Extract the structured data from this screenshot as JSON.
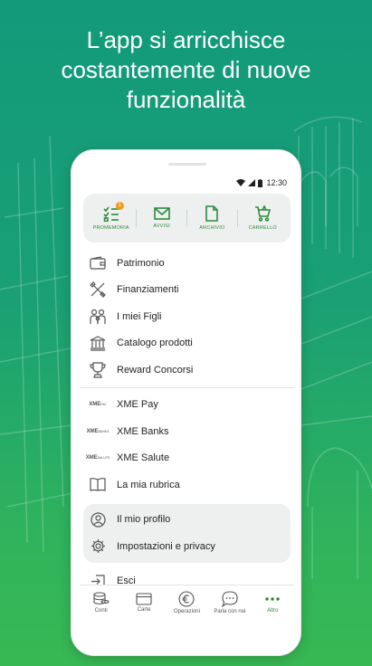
{
  "headline": {
    "line1": "L’app si arricchisce",
    "line2": "costantemente di nuove",
    "line3": "funzionalità"
  },
  "status_bar": {
    "time": "12:30"
  },
  "quick_actions": [
    {
      "label": "PROMEMORIA",
      "icon": "checklist-icon",
      "badge": "1"
    },
    {
      "label": "AVVISI",
      "icon": "envelope-icon"
    },
    {
      "label": "ARCHIVIO",
      "icon": "document-icon"
    },
    {
      "label": "CARRELLO",
      "icon": "cart-icon"
    }
  ],
  "menu_group1": [
    {
      "label": "Patrimonio",
      "icon": "wallet-icon"
    },
    {
      "label": "Finanziamenti",
      "icon": "tools-icon"
    },
    {
      "label": "I miei Figli",
      "icon": "family-icon"
    },
    {
      "label": "Catalogo prodotti",
      "icon": "bank-icon"
    },
    {
      "label": "Reward Concorsi",
      "icon": "trophy-icon"
    }
  ],
  "menu_group2": [
    {
      "label": "XME Pay",
      "icon": "xme-pay-icon",
      "logo_top": "XME",
      "logo_bottom": "PAY"
    },
    {
      "label": "XME Banks",
      "icon": "xme-banks-icon",
      "logo_top": "XME",
      "logo_bottom": "BANKS"
    },
    {
      "label": "XME Salute",
      "icon": "xme-salute-icon",
      "logo_top": "XME",
      "logo_bottom": "SALUTE"
    },
    {
      "label": "La mia rubrica",
      "icon": "address-book-icon"
    }
  ],
  "profile_group": [
    {
      "label": "Il mio profilo",
      "icon": "user-icon"
    },
    {
      "label": "Impostazioni e privacy",
      "icon": "gear-icon"
    }
  ],
  "logout": {
    "label": "Esci",
    "icon": "logout-icon"
  },
  "bottom_nav": [
    {
      "label": "Conti",
      "icon": "coins-icon"
    },
    {
      "label": "Carte",
      "icon": "card-icon"
    },
    {
      "label": "Operazioni",
      "icon": "euro-icon"
    },
    {
      "label": "Parla con noi",
      "icon": "chat-icon"
    },
    {
      "label": "Altro",
      "icon": "more-icon",
      "active": true
    }
  ],
  "colors": {
    "accent": "#2d8a3e",
    "badge": "#f29a1d",
    "panel": "#eef0ef"
  }
}
